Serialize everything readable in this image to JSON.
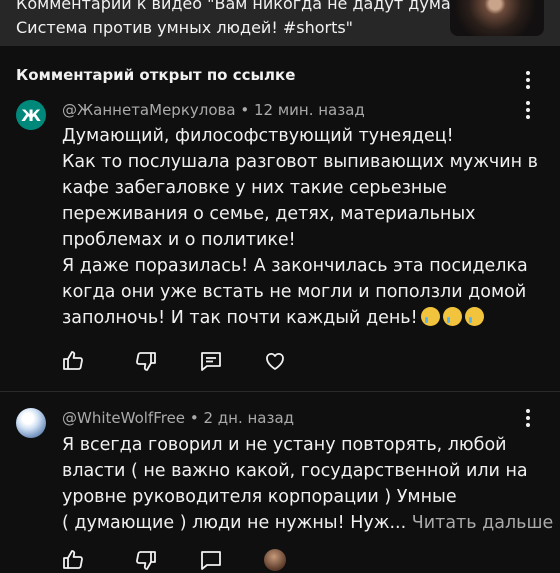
{
  "video": {
    "line1": "Комментарий к видео \"Вам никогда не дадут думать.",
    "line2": "Система против умных людей! #shorts\""
  },
  "section_title": "Комментарий открыт по ссылке",
  "comments": [
    {
      "avatar_letter": "Ж",
      "avatar_color": "#00897b",
      "author": "@ЖаннетаМеркулова",
      "time": "12 мин. назад",
      "lines": [
        "Думающий, философствующий тунеядец!",
        "Как то послушала разговот выпивающих мужчин в",
        "кафе забегаловке у них такие серьезные",
        "переживания о семье, детях, материальных",
        "проблемах и о политике!",
        "Я даже поразилась! А закончилась эта посиделка",
        "когда они уже встать не могли и поползли домой",
        "заполночь! И так почти каждый день!"
      ],
      "emoji": [
        "crying-face",
        "crying-face",
        "crying-face"
      ]
    },
    {
      "author": "@WhiteWolfFree",
      "time": "2 дн. назад",
      "lines": [
        "Я всегда говорил и не устану повторять, любой",
        "власти ( не важно какой, государственной или на",
        "уровне руководителя корпорации ) Умные",
        "( думающие ) люди не нужны! Нуж..."
      ],
      "read_more": "Читать дальше"
    }
  ],
  "separator": "•",
  "icons": {
    "like": "thumbs-up-icon",
    "dislike": "thumbs-down-icon",
    "reply": "comment-icon",
    "heart": "heart-icon",
    "more": "more-vert-icon"
  }
}
